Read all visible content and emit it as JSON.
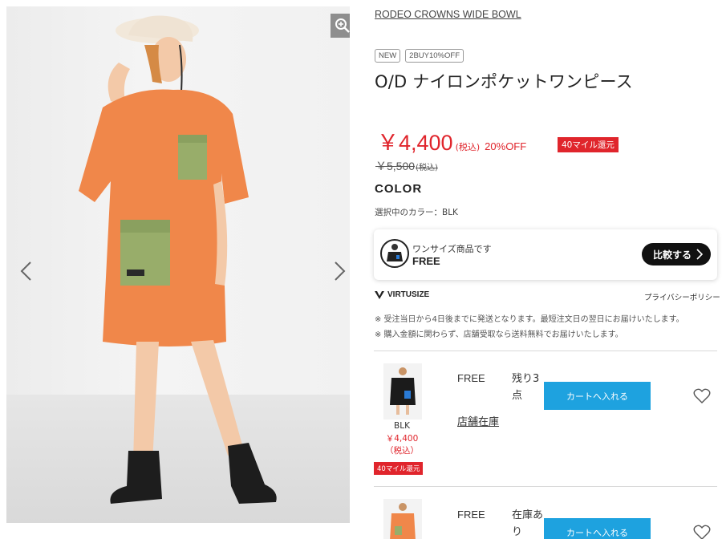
{
  "gallery": {
    "zoom_icon": "zoom-in-icon",
    "prev_icon": "chevron-left-icon",
    "next_icon": "chevron-right-icon"
  },
  "product": {
    "brand": "RODEO CROWNS WIDE BOWL",
    "badges": [
      "NEW",
      "2BUY10%OFF"
    ],
    "name": "O/D ナイロンポケットワンピース",
    "price": "￥4,400",
    "price_tax": "(税込)",
    "discount": "20%OFF",
    "miles": "40マイル還元",
    "original_price": "￥5,500",
    "original_tax": "(税込)"
  },
  "color": {
    "heading": "COLOR",
    "selected": "選択中のカラー：BLK"
  },
  "virtusize": {
    "message": "ワンサイズ商品です",
    "size": "FREE",
    "compare_label": "比較する",
    "logo_text": "VIRTUSIZE",
    "privacy": "プライバシーポリシー"
  },
  "notes": [
    "※ 受注当日から4日後までに発送となります。最短注文日の翌日にお届けいたします。",
    "※ 購入金額に関わらず、店舗受取なら送料無料でお届けいたします。"
  ],
  "stock_rows": [
    {
      "color": "BLK",
      "price": "￥4,400",
      "price_tax": "（税込）",
      "miles": "40マイル還元",
      "size": "FREE",
      "stock": "残り3点",
      "store_link": "店舗在庫",
      "cart_label": "カートへ入れる",
      "favorite_icon": "heart-icon"
    },
    {
      "size": "FREE",
      "stock": "在庫あり",
      "cart_label": "カートへ入れる",
      "favorite_icon": "heart-icon"
    }
  ],
  "colors": {
    "accent_red": "#e0252c",
    "cart_blue": "#1ea2df",
    "dress_orange": "#f0874a",
    "pocket_green": "#98ad6a"
  }
}
